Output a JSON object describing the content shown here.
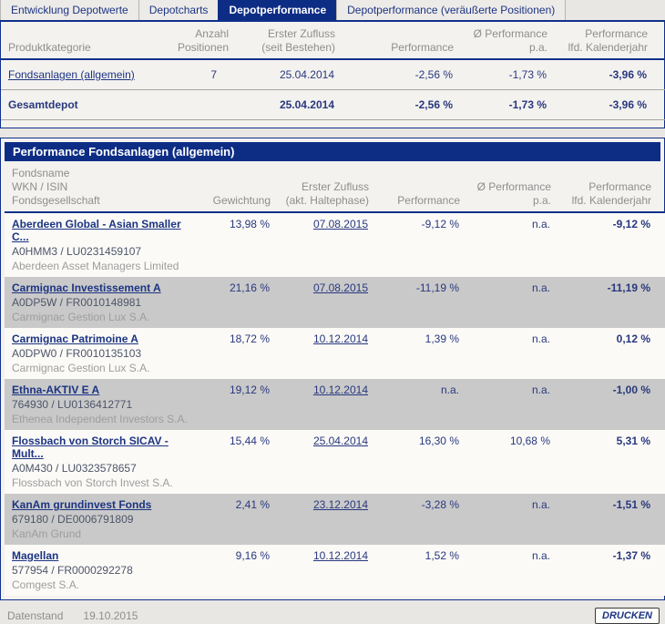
{
  "colors": {
    "navy_bar": "#0d2d85",
    "navy_border": "#10318c",
    "link_navy": "#1c3482",
    "value_navy": "#29387e",
    "row_gray": "#c9c9c9",
    "row_light": "#fbfaf7",
    "panel_bg": "#f3f2ef",
    "page_bg": "#e9e7e4",
    "header_gray": "#8e8e8e"
  },
  "tabs": [
    {
      "label": "Entwicklung Depotwerte",
      "active": false
    },
    {
      "label": "Depotcharts",
      "active": false
    },
    {
      "label": "Depotperformance",
      "active": true
    },
    {
      "label": "Depotperformance (veräußerte Positionen)",
      "active": false
    }
  ],
  "summary_table": {
    "headers": [
      "Produktkategorie",
      "Anzahl\nPositionen",
      "Erster Zufluss\n(seit Bestehen)",
      "Performance",
      "Ø Performance\np.a.",
      "Performance\nlfd. Kalenderjahr"
    ],
    "rows": [
      {
        "category": "Fondsanlagen (allgemein)",
        "count": "7",
        "first_inflow": "25.04.2014",
        "performance": "-2,56 %",
        "performance_pa": "-1,73 %",
        "performance_ytd": "-3,96 %"
      },
      {
        "category": "Gesamtdepot",
        "count": "",
        "first_inflow": "25.04.2014",
        "performance": "-2,56 %",
        "performance_pa": "-1,73 %",
        "performance_ytd": "-3,96 %"
      }
    ]
  },
  "funds_section": {
    "title": "Performance Fondsanlagen (allgemein)",
    "headers": [
      "Fondsname\nWKN / ISIN\nFondsgesellschaft",
      "Gewichtung",
      "Erster Zufluss\n(akt. Haltephase)",
      "Performance",
      "Ø Performance\np.a.",
      "Performance\nlfd. Kalenderjahr"
    ],
    "rows": [
      {
        "name": "Aberdeen Global - Asian Smaller C...",
        "wkn_isin": "A0HMM3 /  LU0231459107",
        "company": "Aberdeen Asset Managers Limited",
        "weight": "13,98 %",
        "first_inflow": "07.08.2015",
        "performance": "-9,12 %",
        "performance_pa": "n.a.",
        "performance_ytd": "-9,12 %"
      },
      {
        "name": "Carmignac Investissement A",
        "wkn_isin": "A0DP5W /  FR0010148981",
        "company": "Carmignac Gestion Lux S.A.",
        "weight": "21,16 %",
        "first_inflow": "07.08.2015",
        "performance": "-11,19 %",
        "performance_pa": "n.a.",
        "performance_ytd": "-11,19 %"
      },
      {
        "name": "Carmignac Patrimoine A",
        "wkn_isin": "A0DPW0 /  FR0010135103",
        "company": "Carmignac Gestion Lux S.A.",
        "weight": "18,72 %",
        "first_inflow": "10.12.2014",
        "performance": "1,39 %",
        "performance_pa": "n.a.",
        "performance_ytd": "0,12 %"
      },
      {
        "name": "Ethna-AKTIV E A",
        "wkn_isin": "764930 /  LU0136412771",
        "company": "Ethenea Independent Investors S.A.",
        "weight": "19,12 %",
        "first_inflow": "10.12.2014",
        "performance": "n.a.",
        "performance_pa": "n.a.",
        "performance_ytd": "-1,00 %"
      },
      {
        "name": "Flossbach von Storch SICAV - Mult...",
        "wkn_isin": "A0M430 /  LU0323578657",
        "company": "Flossbach von Storch Invest S.A.",
        "weight": "15,44 %",
        "first_inflow": "25.04.2014",
        "performance": "16,30 %",
        "performance_pa": "10,68 %",
        "performance_ytd": "5,31 %"
      },
      {
        "name": "KanAm grundinvest Fonds",
        "wkn_isin": "679180 /  DE0006791809",
        "company": "KanAm Grund",
        "weight": "2,41 %",
        "first_inflow": "23.12.2014",
        "performance": "-3,28 %",
        "performance_pa": "n.a.",
        "performance_ytd": "-1,51 %"
      },
      {
        "name": "Magellan",
        "wkn_isin": "577954 /  FR0000292278",
        "company": "Comgest S.A.",
        "weight": "9,16 %",
        "first_inflow": "10.12.2014",
        "performance": "1,52 %",
        "performance_pa": "n.a.",
        "performance_ytd": "-1,37 %"
      }
    ]
  },
  "footer": {
    "label": "Datenstand",
    "date": "19.10.2015",
    "print_button": "DRUCKEN"
  }
}
